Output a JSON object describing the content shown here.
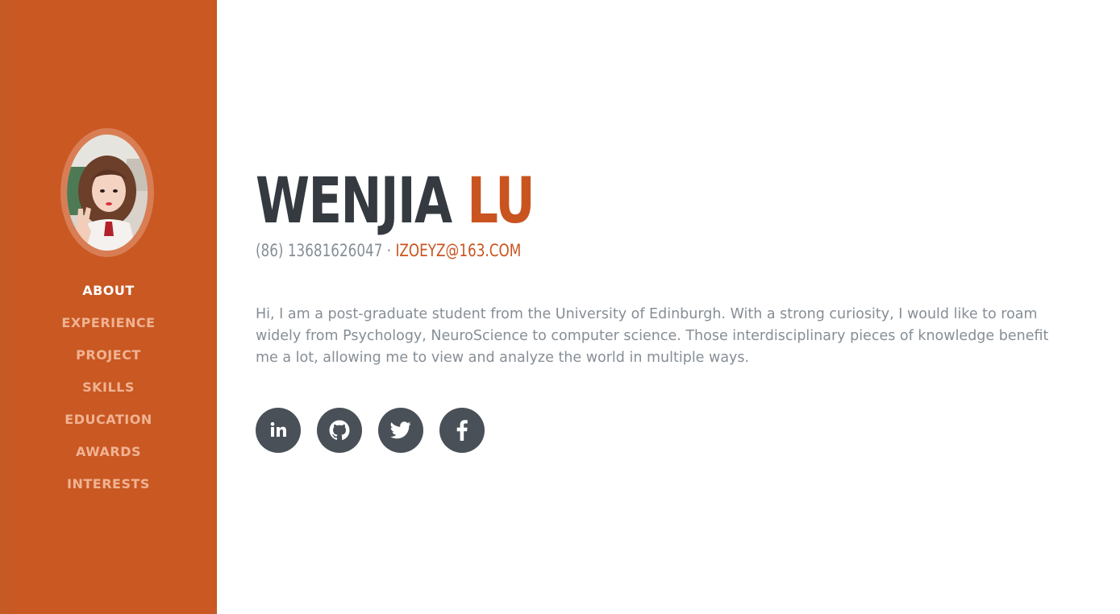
{
  "sidebar": {
    "avatar_label": "Profile photo",
    "nav": [
      {
        "label": "ABOUT",
        "active": true
      },
      {
        "label": "EXPERIENCE",
        "active": false
      },
      {
        "label": "PROJECT",
        "active": false
      },
      {
        "label": "SKILLS",
        "active": false
      },
      {
        "label": "EDUCATION",
        "active": false
      },
      {
        "label": "AWARDS",
        "active": false
      },
      {
        "label": "INTERESTS",
        "active": false
      }
    ]
  },
  "about": {
    "first_name": "WENJIA",
    "last_name": "LU",
    "phone": "(86) 13681626047",
    "separator": "·",
    "email": "izoeyz@163.com",
    "bio": "Hi, I am a post-graduate student from the University of Edinburgh. With a strong curiosity, I would like to roam widely from Psychology, NeuroScience to computer science. Those interdisciplinary pieces of knowledge benefit me a lot, allowing me to view and analyze the world in multiple ways."
  },
  "social": [
    {
      "icon": "linkedin-icon"
    },
    {
      "icon": "github-icon"
    },
    {
      "icon": "twitter-icon"
    },
    {
      "icon": "facebook-icon"
    }
  ],
  "colors": {
    "primary": "#c9541f",
    "sidebar_bg": "#c95823",
    "nav_inactive": "#f0b393",
    "heading": "#343a40",
    "muted_text": "#868e96",
    "social_bg": "#495057"
  }
}
